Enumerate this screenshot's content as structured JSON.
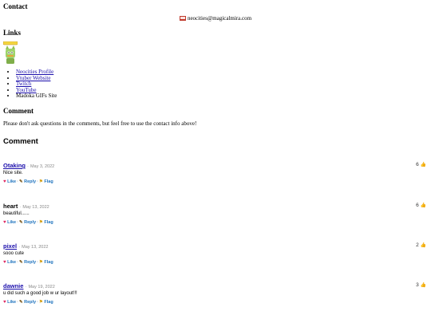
{
  "contact": {
    "heading": "Contact",
    "email": "neocities@magicalmira.com",
    "email_icon": "envelope-icon"
  },
  "links": {
    "heading": "Links",
    "badge_icon": "kirby-badge-icon",
    "items": [
      {
        "label": "Neocities Profile",
        "link": true
      },
      {
        "label": "Vtuber Website",
        "link": true
      },
      {
        "label": "Twitch",
        "link": true
      },
      {
        "label": "YouTube",
        "link": true
      },
      {
        "label": "Madoka GIFs Site",
        "link": false
      }
    ]
  },
  "comment_section": {
    "heading": "Comment",
    "notice": "Please don't ask questions in the comments, but feel free to use the contact info above!",
    "title": "Comment",
    "actions": {
      "like": "Like",
      "reply": "Reply",
      "flag": "Flag",
      "separator": "·"
    },
    "comments": [
      {
        "author": "Otaking",
        "author_link": true,
        "date": "May 3, 2022",
        "text": "Nice site.",
        "votes": "6"
      },
      {
        "author": "heart",
        "author_link": false,
        "date": "May 13, 2022",
        "text": "beautiful......",
        "votes": "6"
      },
      {
        "author": "pixel",
        "author_link": true,
        "date": "May 13, 2022",
        "text": "sooo cute",
        "votes": "2"
      },
      {
        "author": "dawnie",
        "author_link": true,
        "date": "May 19, 2022",
        "text": "u did such a good job w ur layout!!!",
        "votes": "3"
      }
    ]
  },
  "colors": {
    "link": "#1a0dab",
    "action": "#1e73be",
    "date": "#888888",
    "heart": "#e0245e"
  }
}
